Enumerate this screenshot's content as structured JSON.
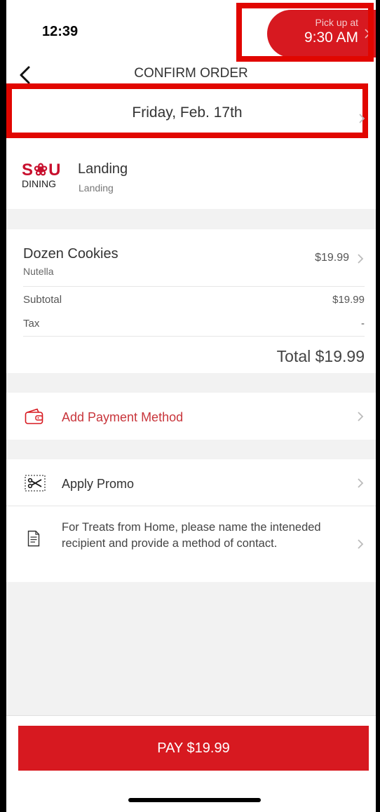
{
  "status": {
    "time": "12:39",
    "signal": "....."
  },
  "nav": {
    "title": "CONFIRM ORDER"
  },
  "date": {
    "label": "Friday, Feb. 17th"
  },
  "restaurant": {
    "logo_top": "S❀U",
    "logo_bottom": "DINING",
    "name": "Landing",
    "location": "Landing",
    "pickup_label": "Pick up at",
    "pickup_time": "9:30 AM"
  },
  "order": {
    "item_name": "Dozen Cookies",
    "item_option": "Nutella",
    "item_price": "$19.99",
    "subtotal_label": "Subtotal",
    "subtotal_value": "$19.99",
    "tax_label": "Tax",
    "tax_value": "-",
    "total": "Total $19.99"
  },
  "payment": {
    "label": "Add Payment Method"
  },
  "promo": {
    "label": "Apply Promo"
  },
  "note": {
    "text": "For Treats from Home, please name the inteneded recipient and provide a method of contact."
  },
  "pay_button": {
    "label": "PAY $19.99"
  },
  "colors": {
    "brand_red": "#d71920",
    "highlight_red": "#e10600"
  },
  "icons": [
    "back-chevron-icon",
    "wifi-icon",
    "battery-icon",
    "chevron-right-icon",
    "wallet-icon",
    "scissors-coupon-icon",
    "document-icon"
  ]
}
